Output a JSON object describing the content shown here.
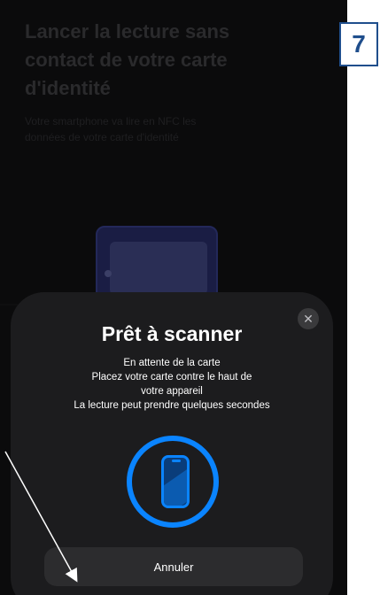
{
  "background": {
    "title_lines": [
      "Lancer la lecture sans",
      "contact de votre carte",
      "d'identité"
    ],
    "subtitle_lines": [
      "Votre smartphone va lire en NFC les",
      "données de votre carte d'identité"
    ]
  },
  "sheet": {
    "title": "Prêt à scanner",
    "messages": [
      "En attente de la carte",
      "Placez votre carte contre le haut de",
      "votre appareil",
      "La lecture peut prendre quelques secondes"
    ],
    "close_icon": "close-icon",
    "cancel_label": "Annuler"
  },
  "step_badge": "7",
  "colors": {
    "accent": "#0a84ff",
    "sheet_bg": "#1c1c1e",
    "badge_border": "#1f4e8c"
  }
}
